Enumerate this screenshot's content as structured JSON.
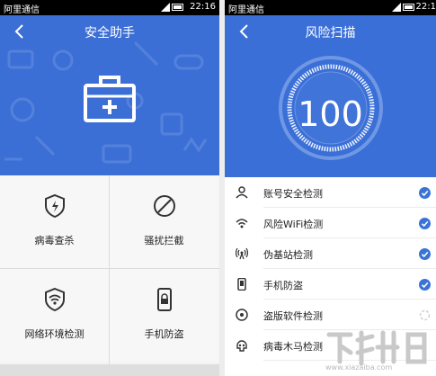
{
  "left_screen": {
    "status": {
      "carrier": "阿里通信",
      "time": "22:16"
    },
    "title": "安全助手",
    "tiles": [
      {
        "label": "病毒查杀",
        "icon": "shield-bolt-icon"
      },
      {
        "label": "骚扰拦截",
        "icon": "block-icon"
      },
      {
        "label": "网络环境检测",
        "icon": "wifi-shield-icon"
      },
      {
        "label": "手机防盗",
        "icon": "phone-lock-icon"
      }
    ]
  },
  "right_screen": {
    "status": {
      "carrier": "阿里通信",
      "time": "22:1"
    },
    "title": "风险扫描",
    "score": "100",
    "items": [
      {
        "label": "账号安全检测",
        "icon": "user-icon",
        "checked": true
      },
      {
        "label": "风险WiFi检测",
        "icon": "wifi-icon",
        "checked": true
      },
      {
        "label": "伪基站检测",
        "icon": "antenna-icon",
        "checked": true
      },
      {
        "label": "手机防盗",
        "icon": "phone-icon",
        "checked": true
      },
      {
        "label": "盗版软件检测",
        "icon": "disc-icon",
        "checked": false
      },
      {
        "label": "病毒木马检测",
        "icon": "skull-icon",
        "checked": false
      }
    ]
  },
  "colors": {
    "primary": "#3c6fd6",
    "check": "#3a73d6"
  },
  "watermark": {
    "url": "www.xiazaiba.com"
  }
}
